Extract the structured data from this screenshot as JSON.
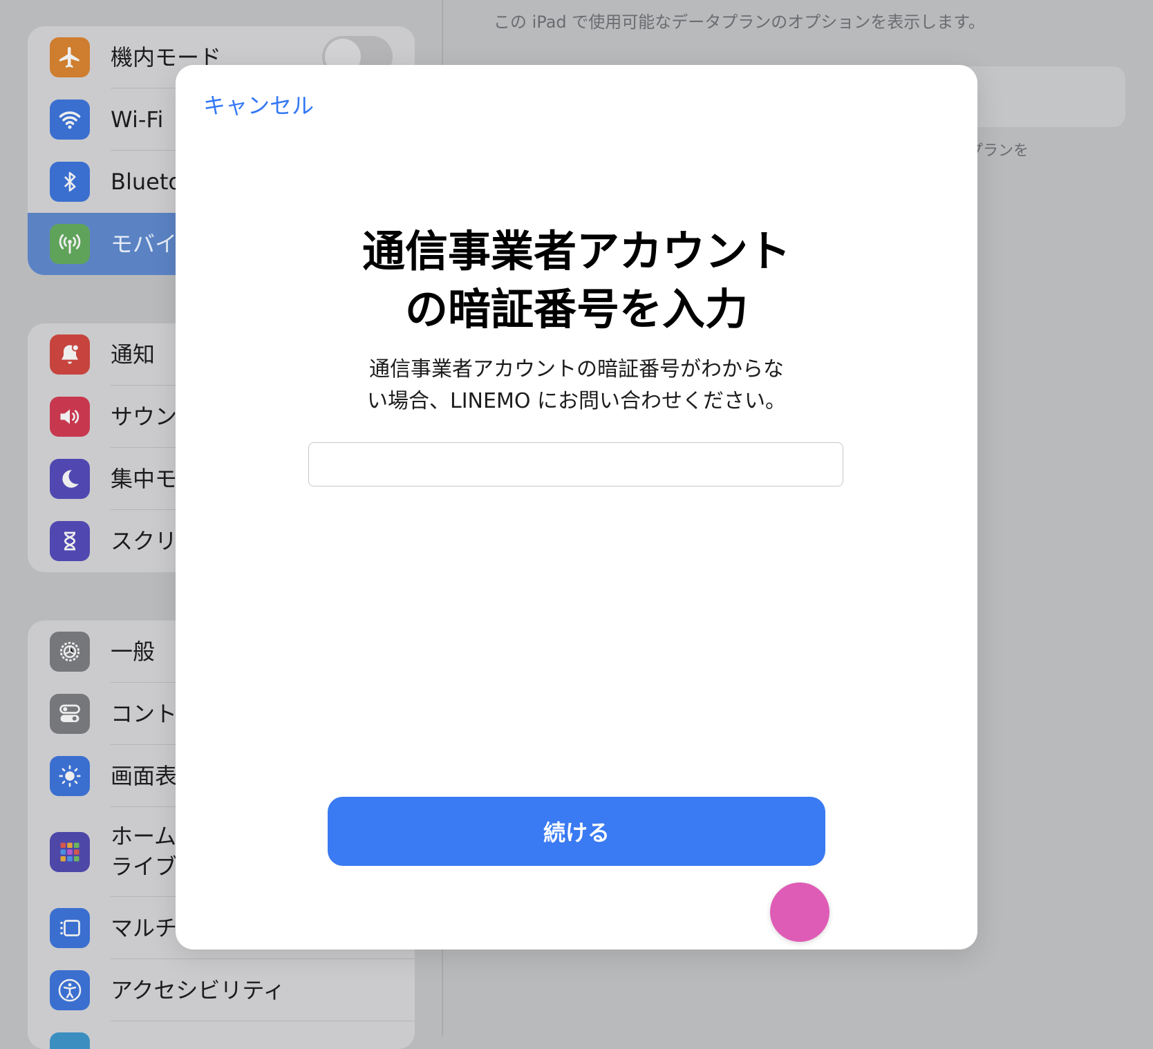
{
  "background": {
    "note": "この iPad で使用可能なデータプランのオプションを表示します。",
    "fragment": "プランを",
    "airplane": {
      "label": "機内モード",
      "toggle": "off"
    },
    "sidebar_groups": [
      [
        {
          "label": "Wi-Fi",
          "icon": "wifi-icon",
          "color": "#3a6fd0"
        },
        {
          "label": "Blueto",
          "icon": "bluetooth-icon",
          "color": "#3a6fd0"
        },
        {
          "label": "モバイ",
          "icon": "antenna-icon",
          "color": "#5fa35a",
          "selected": true
        }
      ],
      [
        {
          "label": "通知",
          "icon": "notification-icon",
          "color": "#c7443e"
        },
        {
          "label": "サウン",
          "icon": "speaker-icon",
          "color": "#c7384f"
        },
        {
          "label": "集中モ",
          "icon": "moon-icon",
          "color": "#5048b0"
        },
        {
          "label": "スクリ",
          "icon": "hourglass-icon",
          "color": "#5048b0"
        }
      ],
      [
        {
          "label": "一般",
          "icon": "gear-icon",
          "color": "#76777b"
        },
        {
          "label": "コント",
          "icon": "switches-icon",
          "color": "#76777b"
        },
        {
          "label": "画面表",
          "icon": "sun-icon",
          "color": "#3a6fd0"
        },
        {
          "label": "ホーム\nライブ",
          "icon": "app-grid-icon",
          "color": "#4d47a8",
          "tall": true
        },
        {
          "label": "マルチ",
          "icon": "multitasking-icon",
          "color": "#3a6fd0"
        },
        {
          "label": "アクセシビリティ",
          "icon": "accessibility-icon",
          "color": "#3a6fd0"
        }
      ]
    ]
  },
  "modal": {
    "cancel_label": "キャンセル",
    "title": "通信事業者アカウント\nの暗証番号を入力",
    "subtitle": "通信事業者アカウントの暗証番号がわからな\nい場合、LINEMO にお問い合わせください。",
    "pin_value": "",
    "pin_placeholder": "",
    "continue_label": "続ける"
  }
}
